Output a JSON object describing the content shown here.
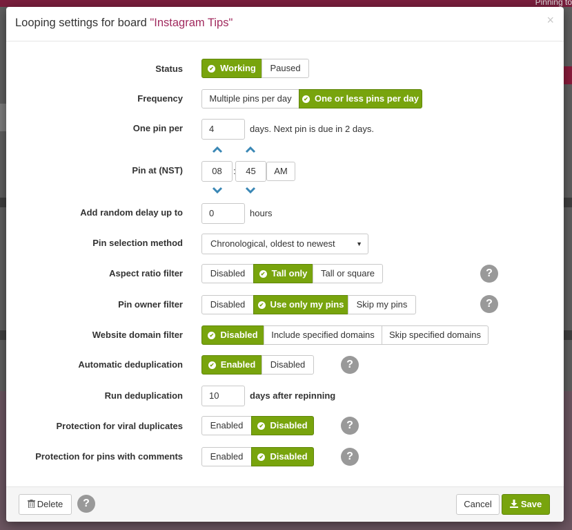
{
  "background": {
    "top_right_text": "Pinning to"
  },
  "modal": {
    "title_prefix": "Looping settings for board ",
    "board_name": "\"Instagram Tips\"",
    "close_symbol": "×"
  },
  "form": {
    "status": {
      "label": "Status",
      "options": [
        "Working",
        "Paused"
      ],
      "selected": "Working"
    },
    "frequency": {
      "label": "Frequency",
      "options": [
        "Multiple pins per day",
        "One or less pins per day"
      ],
      "selected": "One or less pins per day"
    },
    "one_pin_per": {
      "label": "One pin per",
      "value": "4",
      "suffix": "days. Next pin is due in 2 days."
    },
    "pin_at": {
      "label": "Pin at (NST)",
      "hour": "08",
      "separator": ":",
      "minute": "45",
      "ampm": "AM"
    },
    "random_delay": {
      "label": "Add random delay up to",
      "value": "0",
      "suffix": "hours"
    },
    "pin_selection": {
      "label": "Pin selection method",
      "value": "Chronological, oldest to newest"
    },
    "aspect_ratio": {
      "label": "Aspect ratio filter",
      "options": [
        "Disabled",
        "Tall only",
        "Tall or square"
      ],
      "selected": "Tall only"
    },
    "pin_owner": {
      "label": "Pin owner filter",
      "options": [
        "Disabled",
        "Use only my pins",
        "Skip my pins"
      ],
      "selected": "Use only my pins"
    },
    "website_domain": {
      "label": "Website domain filter",
      "options": [
        "Disabled",
        "Include specified domains",
        "Skip specified domains"
      ],
      "selected": "Disabled"
    },
    "auto_dedup": {
      "label": "Automatic deduplication",
      "options": [
        "Enabled",
        "Disabled"
      ],
      "selected": "Enabled"
    },
    "run_dedup": {
      "label": "Run deduplication",
      "value": "10",
      "suffix": "days after repinning"
    },
    "viral_protection": {
      "label": "Protection for viral duplicates",
      "options": [
        "Enabled",
        "Disabled"
      ],
      "selected": "Disabled"
    },
    "comments_protection": {
      "label": "Protection for pins with comments",
      "options": [
        "Enabled",
        "Disabled"
      ],
      "selected": "Disabled"
    },
    "help_symbol": "?"
  },
  "footer": {
    "delete_label": "Delete",
    "cancel_label": "Cancel",
    "save_label": "Save"
  },
  "colors": {
    "accent_green": "#78a40d",
    "board_name": "#a12a5e",
    "help_grey": "#999999"
  }
}
